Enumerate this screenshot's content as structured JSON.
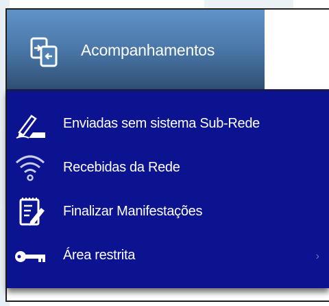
{
  "header": {
    "title": "Acompanhamentos",
    "icon": "documents-exchange-icon"
  },
  "menu": {
    "items": [
      {
        "label": "Enviadas sem sistema Sub-Rede",
        "icon": "signature-pen-icon"
      },
      {
        "label": "Recebidas da Rede",
        "icon": "wifi-signal-icon"
      },
      {
        "label": "Finalizar Manifestações",
        "icon": "document-edit-icon"
      },
      {
        "label": "Área restrita",
        "icon": "key-icon",
        "has_submenu": true,
        "chevron": "›"
      }
    ]
  },
  "colors": {
    "menu_bg": "#0b1390",
    "header_top": "#5f93c8",
    "header_bottom": "#2f4f72",
    "text": "#ffffff"
  }
}
